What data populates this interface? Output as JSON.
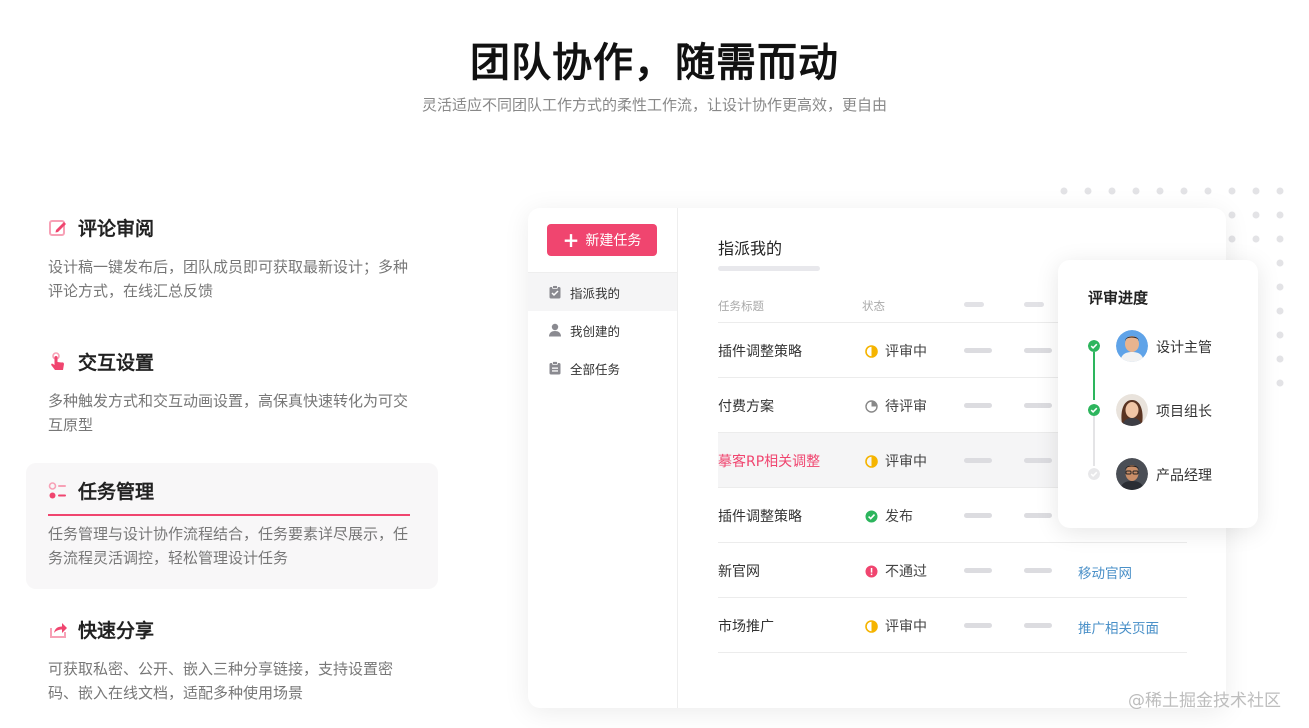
{
  "hero": {
    "title": "团队协作，随需而动",
    "subtitle": "灵活适应不同团队工作方式的柔性工作流，让设计协作更高效，更自由"
  },
  "features": [
    {
      "title": "评论审阅",
      "desc": "设计稿一键发布后，团队成员即可获取最新设计；多种评论方式，在线汇总反馈",
      "icon": "edit-icon"
    },
    {
      "title": "交互设置",
      "desc": "多种触发方式和交互动画设置，高保真快速转化为可交互原型",
      "icon": "tap-hand-icon"
    },
    {
      "title": "任务管理",
      "desc": "任务管理与设计协作流程结合，任务要素详尽展示，任务流程灵活调控，轻松管理设计任务",
      "icon": "task-list-icon",
      "active": true
    },
    {
      "title": "快速分享",
      "desc": "可获取私密、公开、嵌入三种分享链接，支持设置密码、嵌入在线文档，适配多种使用场景",
      "icon": "share-icon"
    }
  ],
  "panel": {
    "new_task_label": "新建任务",
    "nav": [
      {
        "label": "指派我的",
        "icon": "clipboard-check-icon"
      },
      {
        "label": "我创建的",
        "icon": "user-icon"
      },
      {
        "label": "全部任务",
        "icon": "clipboard-icon"
      }
    ],
    "main_title": "指派我的",
    "columns": {
      "title": "任务标题",
      "status": "状态"
    },
    "rows": [
      {
        "title": "插件调整策略",
        "status": "评审中",
        "status_icon": "half-circle-icon",
        "link": ""
      },
      {
        "title": "付费方案",
        "status": "待评审",
        "status_icon": "pie-icon",
        "link": ""
      },
      {
        "title": "摹客RP相关调整",
        "status": "评审中",
        "status_icon": "half-circle-icon",
        "link": ""
      },
      {
        "title": "插件调整策略",
        "status": "发布",
        "status_icon": "check-circle-icon",
        "link": ""
      },
      {
        "title": "新官网",
        "status": "不通过",
        "status_icon": "alert-circle-icon",
        "link": "移动官网"
      },
      {
        "title": "市场推广",
        "status": "评审中",
        "status_icon": "half-circle-icon",
        "link": "推广相关页面"
      }
    ]
  },
  "review": {
    "title": "评审进度",
    "steps": [
      {
        "name": "设计主管",
        "done": true
      },
      {
        "name": "项目组长",
        "done": true
      },
      {
        "name": "产品经理",
        "done": false
      }
    ]
  },
  "watermark": "@稀土掘金技术社区",
  "colors": {
    "accent": "#f0456f",
    "success": "#2db55d",
    "warning": "#f5b400",
    "danger": "#f0456f",
    "link": "#4a90c8"
  }
}
